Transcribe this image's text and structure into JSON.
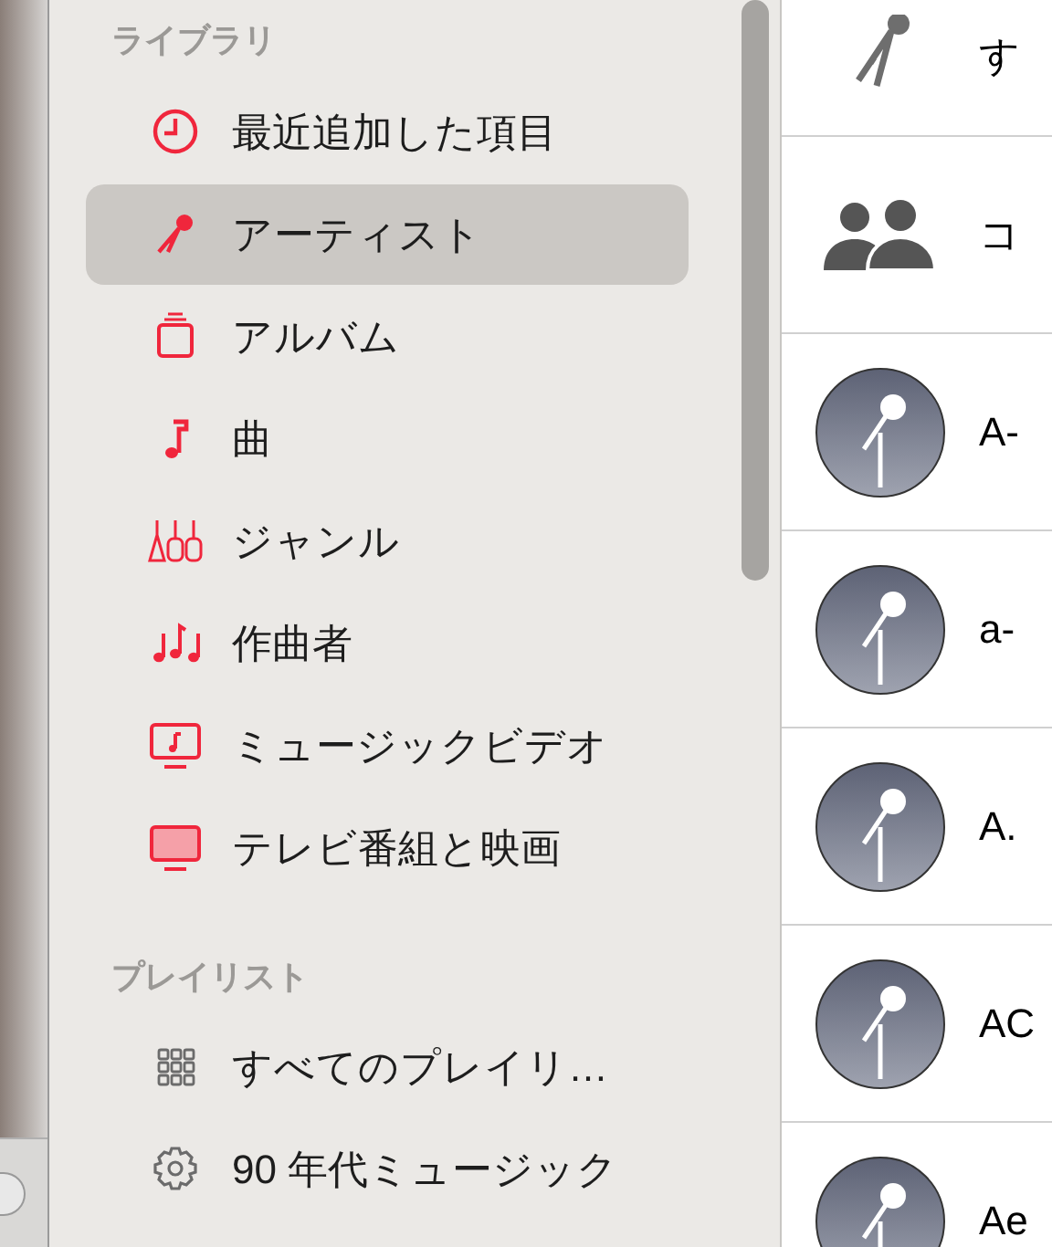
{
  "library": {
    "heading": "ライブラリ",
    "items": [
      {
        "kind": "clock",
        "label": "最近追加した項目",
        "selected": false
      },
      {
        "kind": "mic",
        "label": "アーティスト",
        "selected": true
      },
      {
        "kind": "album",
        "label": "アルバム",
        "selected": false
      },
      {
        "kind": "note",
        "label": "曲",
        "selected": false
      },
      {
        "kind": "guitars",
        "label": "ジャンル",
        "selected": false
      },
      {
        "kind": "notes",
        "label": "作曲者",
        "selected": false
      },
      {
        "kind": "video",
        "label": "ミュージックビデオ",
        "selected": false
      },
      {
        "kind": "tv",
        "label": "テレビ番組と映画",
        "selected": false
      }
    ]
  },
  "playlists": {
    "heading": "プレイリスト",
    "items": [
      {
        "kind": "grid",
        "label": "すべてのプレイリ…",
        "selected": false
      },
      {
        "kind": "gear",
        "label": "90 年代ミュージック",
        "selected": false
      }
    ]
  },
  "artists": [
    {
      "kind": "all",
      "name": "す"
    },
    {
      "kind": "compilation",
      "name": "コ"
    },
    {
      "kind": "artist",
      "name": "A-"
    },
    {
      "kind": "artist",
      "name": "a-"
    },
    {
      "kind": "artist",
      "name": "A."
    },
    {
      "kind": "artist",
      "name": "AC"
    },
    {
      "kind": "artist",
      "name": "Ae"
    }
  ]
}
